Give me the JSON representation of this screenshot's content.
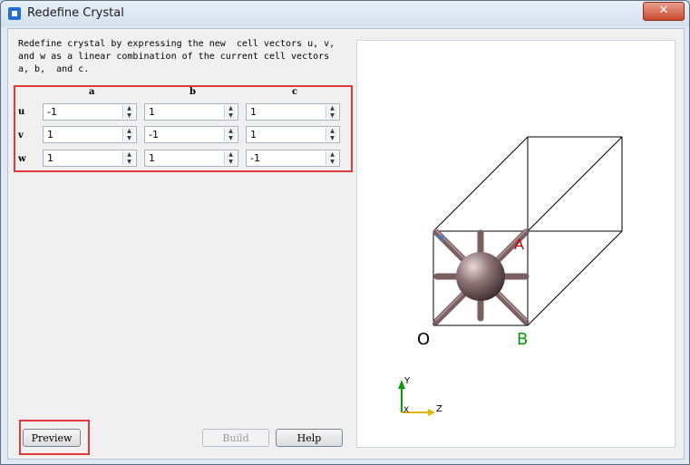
{
  "window": {
    "title": "Redefine Crystal",
    "close_symbol": "✕"
  },
  "description": "Redefine crystal by expressing the new  cell vectors u, v,\nand w as a linear combination of the current cell vectors\na, b,  and c.",
  "matrix": {
    "columns": [
      "a",
      "b",
      "c"
    ],
    "rows": [
      {
        "label": "u",
        "values": [
          "-1",
          "1",
          "1"
        ]
      },
      {
        "label": "v",
        "values": [
          "1",
          "-1",
          "1"
        ]
      },
      {
        "label": "w",
        "values": [
          "1",
          "1",
          "-1"
        ]
      }
    ]
  },
  "buttons": {
    "preview": "Preview",
    "build": "Build",
    "help": "Help"
  },
  "viewer": {
    "corner_labels": {
      "origin": "O",
      "b": "B",
      "a": "A"
    },
    "axis_labels": {
      "y": "Y",
      "x": "X",
      "z": "Z"
    },
    "colors": {
      "a": "#cc0000",
      "b": "#0a9a0a",
      "c": "#3a7fd0",
      "atom": "#8a6f72",
      "bond": "#7a5e60"
    }
  }
}
